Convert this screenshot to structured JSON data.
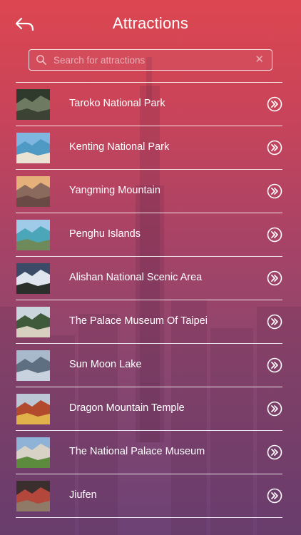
{
  "header": {
    "title": "Attractions"
  },
  "search": {
    "placeholder": "Search for attractions"
  },
  "attractions": [
    {
      "name": "Taroko National Park",
      "thumb": {
        "sky": "#2f3a2c",
        "mid": "#6f7a63",
        "ground": "#3c4334"
      }
    },
    {
      "name": "Kenting National Park",
      "thumb": {
        "sky": "#7fb6e0",
        "mid": "#4e9ac4",
        "ground": "#e8e3d2"
      }
    },
    {
      "name": "Yangming Mountain",
      "thumb": {
        "sky": "#e6b07a",
        "mid": "#8a6a5c",
        "ground": "#6a4a44"
      }
    },
    {
      "name": "Penghu Islands",
      "thumb": {
        "sky": "#9fcbe8",
        "mid": "#4aa6b8",
        "ground": "#6e8a5a"
      }
    },
    {
      "name": "Alishan National Scenic Area",
      "thumb": {
        "sky": "#3b4a66",
        "mid": "#dfe5ee",
        "ground": "#2b2f2c"
      }
    },
    {
      "name": "The Palace Museum Of Taipei",
      "thumb": {
        "sky": "#c9d4dc",
        "mid": "#3e5a3a",
        "ground": "#d7cfc0"
      }
    },
    {
      "name": "Sun Moon Lake",
      "thumb": {
        "sky": "#a9b9cc",
        "mid": "#5e6f82",
        "ground": "#c7d2de"
      }
    },
    {
      "name": "Dragon Mountain Temple",
      "thumb": {
        "sky": "#bcc7d6",
        "mid": "#b24a2e",
        "ground": "#e2b24a"
      }
    },
    {
      "name": "The National Palace Museum",
      "thumb": {
        "sky": "#8fb3d6",
        "mid": "#d8d2c6",
        "ground": "#5d8b3e"
      }
    },
    {
      "name": "Jiufen",
      "thumb": {
        "sky": "#3a2e2e",
        "mid": "#b3473b",
        "ground": "#8e7a66"
      }
    }
  ]
}
